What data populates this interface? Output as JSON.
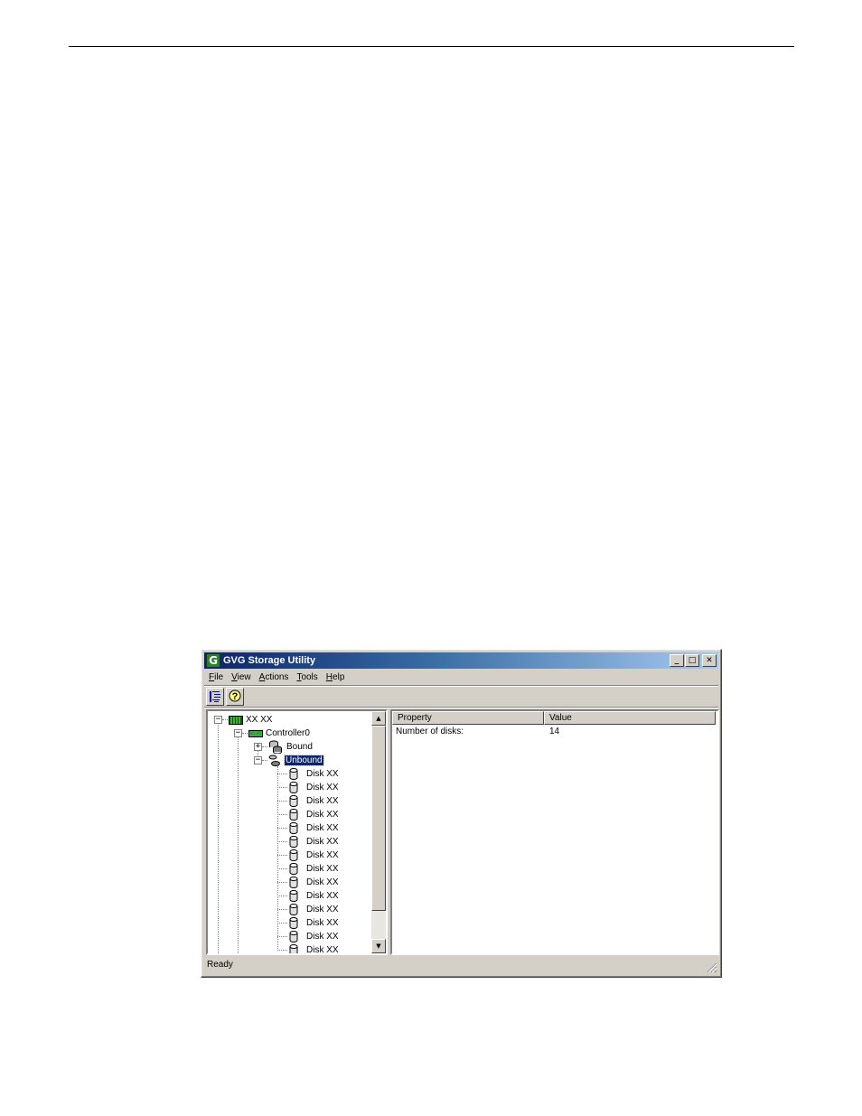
{
  "window": {
    "title": "GVG Storage Utility",
    "icon_letter": "G",
    "buttons": {
      "minimize": "_",
      "maximize": "□",
      "close": "✕"
    }
  },
  "menu": [
    {
      "label_accel": "F",
      "label_rest": "ile"
    },
    {
      "label_accel": "V",
      "label_rest": "iew"
    },
    {
      "label_accel": "A",
      "label_rest": "ctions"
    },
    {
      "label_accel": "T",
      "label_rest": "ools"
    },
    {
      "label_accel": "H",
      "label_rest": "elp"
    }
  ],
  "toolbar": {
    "buttons": [
      {
        "icon": "tree-view-icon"
      },
      {
        "icon": "help-icon",
        "glyph": "?"
      }
    ]
  },
  "tree": {
    "root": {
      "label": "XX XX",
      "icon": "chassis-icon",
      "expanded": true
    },
    "controller": {
      "label": "Controller0",
      "icon": "controller-icon",
      "expanded": true
    },
    "bound": {
      "label": "Bound",
      "icon": "disk-group-icon",
      "expanded": false
    },
    "unbound": {
      "label": "Unbound",
      "icon": "disk-stack-icon",
      "expanded": true,
      "selected": true
    },
    "disks": [
      "Disk XX",
      "Disk XX",
      "Disk XX",
      "Disk XX",
      "Disk XX",
      "Disk XX",
      "Disk XX",
      "Disk XX",
      "Disk XX",
      "Disk XX",
      "Disk XX",
      "Disk XX",
      "Disk XX",
      "Disk XX"
    ]
  },
  "list": {
    "columns": [
      "Property",
      "Value"
    ],
    "rows": [
      {
        "property": "Number of disks:",
        "value": "14"
      }
    ]
  },
  "status": {
    "text": "Ready"
  },
  "colors": {
    "title_active": "#0a246a",
    "title_gradient_end": "#a6caf0",
    "chrome": "#d4d0c8",
    "selection": "#0a246a"
  }
}
